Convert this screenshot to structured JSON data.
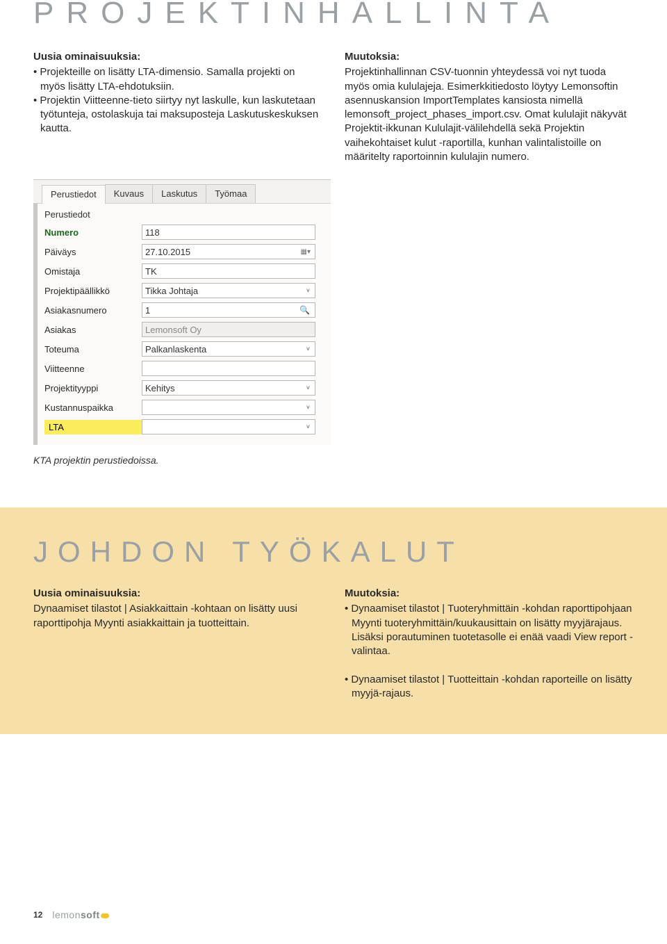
{
  "section1": {
    "title": "PROJEKTINHALLINTA",
    "left": {
      "heading": "Uusia ominaisuuksia:",
      "bullets": [
        "Projekteille on lisätty LTA-dimensio. Samalla projekti on myös lisätty LTA-ehdotuksiin.",
        "Projektin Viitteenne-tieto siirtyy nyt laskulle, kun laskutetaan työtunteja, ostolaskuja tai maksuposteja Laskutuskeskuksen kautta."
      ]
    },
    "right": {
      "heading": "Muutoksia:",
      "text": "Projektinhallinnan CSV-tuonnin yhteydessä voi nyt tuoda myös omia kululajeja. Esimerkkitiedosto löytyy Lemonsoftin asennuskansion ImportTemplates kansiosta nimellä lemonsoft_project_phases_import.csv. Omat kululajit näkyvät Projektit-ikkunan Kululajit-välilehdellä sekä Projektin vaihekohtaiset kulut -raportilla, kunhan valintalistoille on määritelty raportoinnin kululajin numero."
    },
    "screenshot": {
      "tabs": [
        "Perustiedot",
        "Kuvaus",
        "Laskutus",
        "Työmaa"
      ],
      "section_label": "Perustiedot",
      "rows": [
        {
          "label": "Numero",
          "value": "118",
          "bold": true
        },
        {
          "label": "Päiväys",
          "value": "27.10.2015",
          "calendar": true
        },
        {
          "label": "Omistaja",
          "value": "TK"
        },
        {
          "label": "Projektipäällikkö",
          "value": "Tikka Johtaja",
          "dropdown": true
        },
        {
          "label": "Asiakasnumero",
          "value": "1",
          "search": true
        },
        {
          "label": "Asiakas",
          "value": "Lemonsoft Oy",
          "readonly": true
        },
        {
          "label": "Toteuma",
          "value": "Palkanlaskenta",
          "dropdown": true
        },
        {
          "label": "Viitteenne",
          "value": ""
        },
        {
          "label": "Projektityyppi",
          "value": "Kehitys",
          "dropdown": true
        },
        {
          "label": "Kustannuspaikka",
          "value": "",
          "dropdown": true
        }
      ],
      "lta_label": "LTA",
      "caption": "KTA projektin perustiedoissa."
    }
  },
  "section2": {
    "title": "JOHDON TYÖKALUT",
    "left": {
      "heading": "Uusia ominaisuuksia:",
      "text": "Dynaamiset tilastot | Asiakkaittain -kohtaan on lisätty uusi raporttipohja Myynti asiakkaittain ja tuotteittain."
    },
    "right": {
      "heading": "Muutoksia:",
      "bullets": [
        "Dynaamiset tilastot | Tuoteryhmittäin -kohdan raporttipohjaan Myynti tuoteryhmittäin/kuukausittain on lisätty myyjärajaus. Lisäksi porautuminen tuotetasolle ei enää vaadi View report -valintaa.",
        "Dynaamiset tilastot | Tuotteittain -kohdan raporteille on lisätty myyjä-rajaus."
      ]
    }
  },
  "footer": {
    "page": "12",
    "logo_lemon": "lemon",
    "logo_soft": "soft"
  }
}
